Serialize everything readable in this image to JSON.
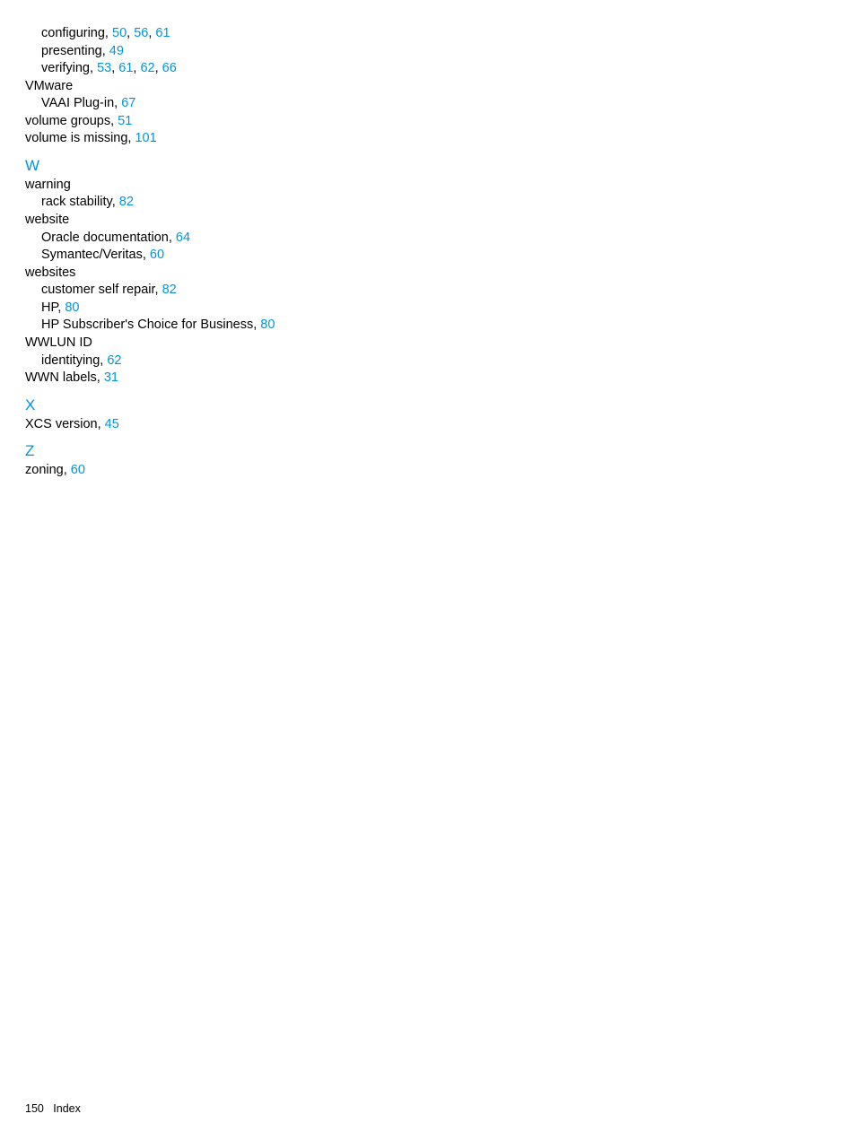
{
  "entries_top": [
    {
      "text": "configuring, ",
      "pages": [
        "50",
        "56",
        "61"
      ],
      "indent": "i1"
    },
    {
      "text": "presenting, ",
      "pages": [
        "49"
      ],
      "indent": "i1"
    },
    {
      "text": "verifying, ",
      "pages": [
        "53",
        "61",
        "62",
        "66"
      ],
      "indent": "i1"
    },
    {
      "text": "VMware",
      "pages": [],
      "indent": "i2"
    },
    {
      "text": "VAAI Plug-in, ",
      "pages": [
        "67"
      ],
      "indent": "i1"
    },
    {
      "text": "volume groups, ",
      "pages": [
        "51"
      ],
      "indent": "i2"
    },
    {
      "text": "volume is missing, ",
      "pages": [
        "101"
      ],
      "indent": "i2"
    }
  ],
  "section_w_label": "W",
  "entries_w": [
    {
      "text": "warning",
      "pages": [],
      "indent": "i2"
    },
    {
      "text": "rack stability, ",
      "pages": [
        "82"
      ],
      "indent": "i1"
    },
    {
      "text": "website",
      "pages": [],
      "indent": "i2"
    },
    {
      "text": "Oracle documentation, ",
      "pages": [
        "64"
      ],
      "indent": "i1"
    },
    {
      "text": "Symantec/Veritas, ",
      "pages": [
        "60"
      ],
      "indent": "i1"
    },
    {
      "text": "websites",
      "pages": [],
      "indent": "i2"
    },
    {
      "text": "customer self repair, ",
      "pages": [
        "82"
      ],
      "indent": "i1"
    },
    {
      "text": "HP, ",
      "pages": [
        "80"
      ],
      "indent": "i1"
    },
    {
      "text": "HP Subscriber's Choice for Business, ",
      "pages": [
        "80"
      ],
      "indent": "i1"
    },
    {
      "text": "WWLUN ID",
      "pages": [],
      "indent": "i2"
    },
    {
      "text": "identitying, ",
      "pages": [
        "62"
      ],
      "indent": "i1"
    },
    {
      "text": "WWN labels, ",
      "pages": [
        "31"
      ],
      "indent": "i2"
    }
  ],
  "section_x_label": "X",
  "entries_x": [
    {
      "text": "XCS version, ",
      "pages": [
        "45"
      ],
      "indent": "i2"
    }
  ],
  "section_z_label": "Z",
  "entries_z": [
    {
      "text": "zoning, ",
      "pages": [
        "60"
      ],
      "indent": "i2"
    }
  ],
  "footer": {
    "page_num": "150",
    "section": "Index"
  },
  "sep": ", "
}
